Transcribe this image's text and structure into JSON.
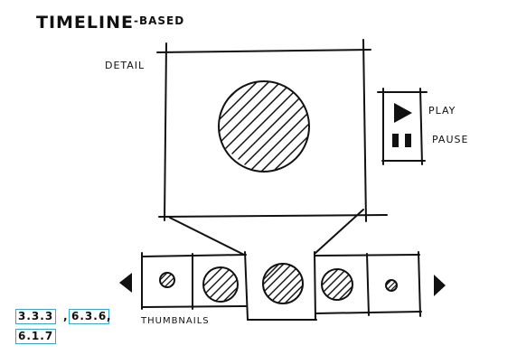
{
  "title": "TIMELINE",
  "title_suffix": "-BASED",
  "labels": {
    "detail": "DETAIL",
    "play": "PLAY",
    "pause": "PAUSE",
    "thumbnails": "THUMBNAILS"
  },
  "tags": [
    "3.3.3",
    "6.3.6",
    "6.1.7"
  ],
  "tag_separator": ",",
  "colors": {
    "ink": "#111111",
    "tag_border": "#3aa8c8"
  }
}
